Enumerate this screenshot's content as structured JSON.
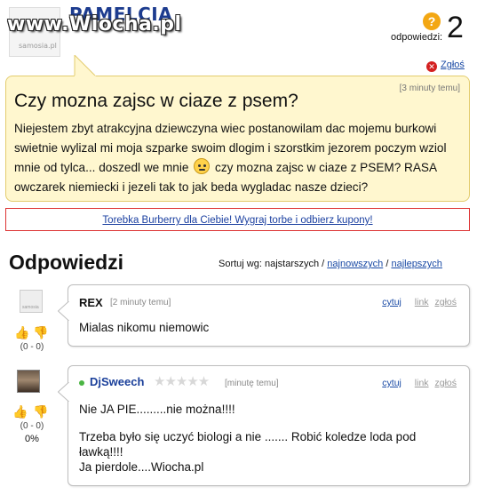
{
  "header": {
    "author": "PAMELCIA",
    "avatar_caption": "samosia.pl",
    "watermark": "www.Wiocha.pl",
    "answers_label": "odpowiedzi:",
    "answers_count": "2",
    "report_label": "Zgłoś",
    "answers_icon": "question-icon"
  },
  "question": {
    "time": "[3 minuty temu]",
    "title": "Czy mozna zajsc w ciaze z psem?",
    "body_part1": "Niejestem zbyt atrakcyjna dziewczyna wiec postanowilam dac mojemu burkowi swietnie wylizal mi moja szparke swoim dlogim i szorstkim jezorem poczym wziol mnie od tylca... doszedl we mnie",
    "emoticon": "worried-face-icon",
    "body_part2": "czy mozna zajsc w ciaze z PSEM? RASA owczarek niemiecki i jezeli tak to jak beda wygladac nasze dzieci?"
  },
  "ad": {
    "text": "Torebka Burberry dla Ciebie! Wygraj torbe i odbierz kupony!"
  },
  "answers_section": {
    "title": "Odpowiedzi",
    "sort_label": "Sortuj wg: najstarszych /",
    "sort_newest": "najnowszych",
    "sort_sep": "/",
    "sort_best": "najlepszych"
  },
  "answers": [
    {
      "author": "REX",
      "avatar_caption": "samosia",
      "time": "[2 minuty temu]",
      "text": "Mialas nikomu niemowic",
      "votes": "(0 - 0)",
      "actions": {
        "quote": "cytuj",
        "link": "link",
        "report": "zgłoś"
      }
    },
    {
      "author": "DjSweech",
      "time": "[minutę temu]",
      "stars": "★★★★★",
      "rating": 0,
      "text_line1": "Nie JA PIE.........nie można!!!!",
      "text_line2": "Trzeba było się uczyć biologi a nie ....... Robić koledze loda pod ławką!!!!",
      "text_line3": "Ja pierdole....Wiocha.pl",
      "votes": "(0 - 0)",
      "percent": "0%",
      "actions": {
        "quote": "cytuj",
        "link": "link",
        "report": "zgłoś"
      }
    }
  ],
  "colors": {
    "question_bg": "#fff7cf",
    "link": "#1a4aa5",
    "author": "#1d3c8f",
    "ad_border": "#dd3333"
  }
}
